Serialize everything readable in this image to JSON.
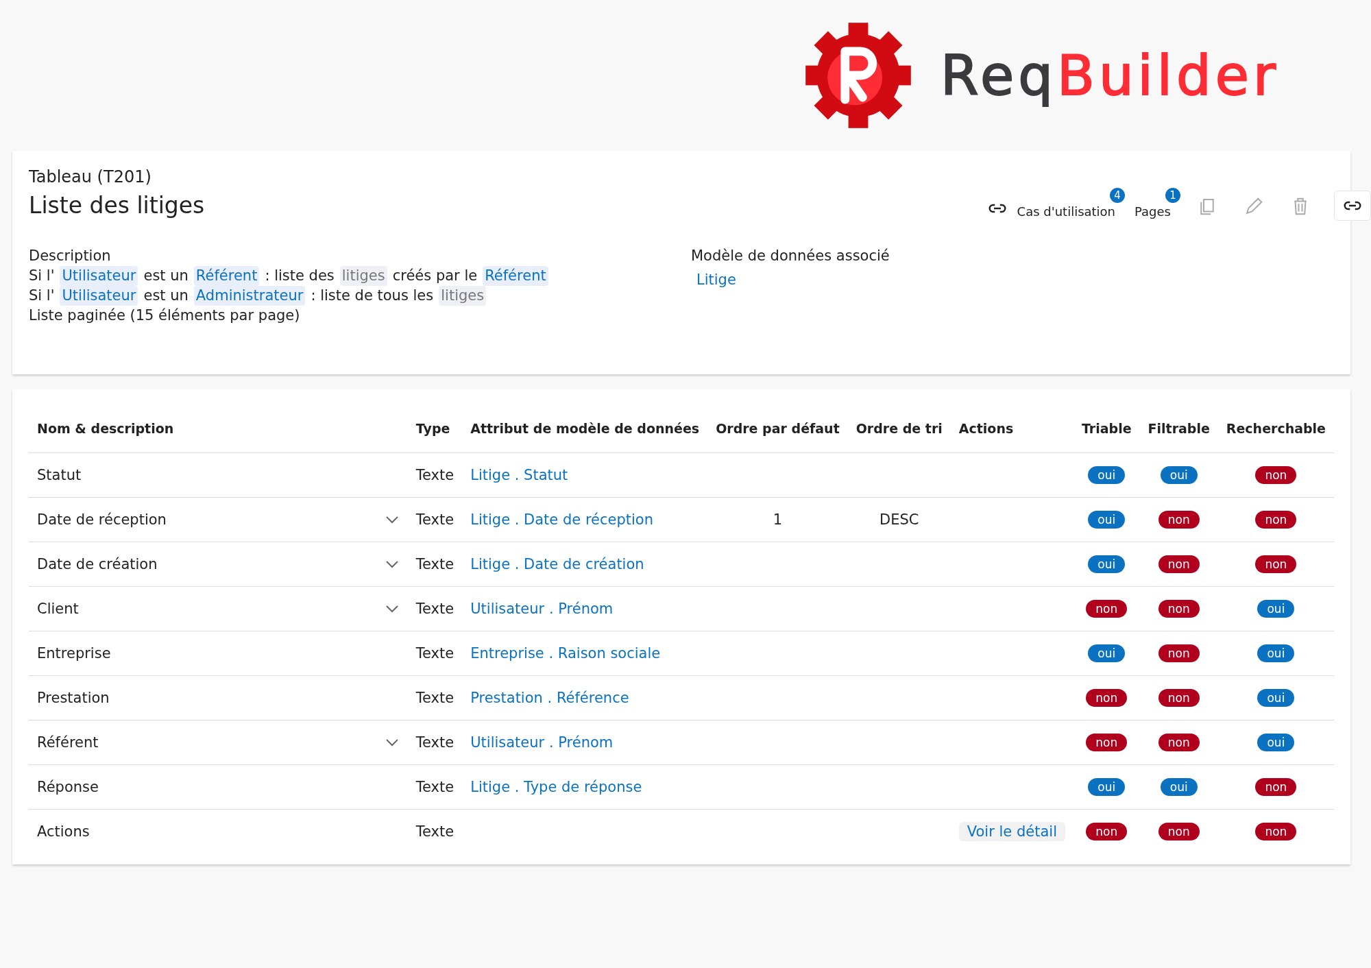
{
  "logo": {
    "part_1": "Req",
    "part_2": "Builder"
  },
  "header": {
    "kind_label": "Tableau (T201)",
    "title": "Liste des litiges",
    "toolbar": {
      "link_label": "Cas d'utilisation",
      "link_count": "4",
      "pages_label": "Pages",
      "pages_count": "1"
    },
    "description": {
      "heading": "Description",
      "lines": [
        [
          {
            "kind": "text",
            "text": "Si l'"
          },
          {
            "kind": "entity",
            "text": "Utilisateur"
          },
          {
            "kind": "text",
            "text": "est un"
          },
          {
            "kind": "entity",
            "text": "Référent"
          },
          {
            "kind": "text",
            "text": ": liste des"
          },
          {
            "kind": "concept",
            "text": "litiges"
          },
          {
            "kind": "text",
            "text": "créés par le"
          },
          {
            "kind": "entity",
            "text": "Référent"
          }
        ],
        [
          {
            "kind": "text",
            "text": "Si l'"
          },
          {
            "kind": "entity",
            "text": "Utilisateur"
          },
          {
            "kind": "text",
            "text": "est un"
          },
          {
            "kind": "entity",
            "text": "Administrateur"
          },
          {
            "kind": "text",
            "text": ": liste de tous les"
          },
          {
            "kind": "concept",
            "text": "litiges"
          }
        ],
        [
          {
            "kind": "text",
            "text": "Liste paginée (15 éléments par page)"
          }
        ]
      ]
    },
    "data_model": {
      "heading": "Modèle de données associé",
      "items": [
        "Litige"
      ]
    }
  },
  "table": {
    "columns": [
      "Nom & description",
      "Type",
      "Attribut de modèle de données",
      "Ordre par défaut",
      "Ordre de tri",
      "Actions",
      "Triable",
      "Filtrable",
      "Recherchable"
    ],
    "rows": [
      {
        "name": "Statut",
        "expandable": false,
        "type": "Texte",
        "attribute": "Litige . Statut",
        "default_order": "",
        "sort_order": "",
        "action": "",
        "triable": {
          "label": "oui",
          "on": true
        },
        "filtrable": {
          "label": "oui",
          "on": true
        },
        "recherchable": {
          "label": "non",
          "on": false
        }
      },
      {
        "name": "Date de réception",
        "expandable": true,
        "type": "Texte",
        "attribute": "Litige . Date de réception",
        "default_order": "1",
        "sort_order": "DESC",
        "action": "",
        "triable": {
          "label": "oui",
          "on": true
        },
        "filtrable": {
          "label": "non",
          "on": false
        },
        "recherchable": {
          "label": "non",
          "on": false
        }
      },
      {
        "name": "Date de création",
        "expandable": true,
        "type": "Texte",
        "attribute": "Litige . Date de création",
        "default_order": "",
        "sort_order": "",
        "action": "",
        "triable": {
          "label": "oui",
          "on": true
        },
        "filtrable": {
          "label": "non",
          "on": false
        },
        "recherchable": {
          "label": "non",
          "on": false
        }
      },
      {
        "name": "Client",
        "expandable": true,
        "type": "Texte",
        "attribute": "Utilisateur . Prénom",
        "default_order": "",
        "sort_order": "",
        "action": "",
        "triable": {
          "label": "non",
          "on": false
        },
        "filtrable": {
          "label": "non",
          "on": false
        },
        "recherchable": {
          "label": "oui",
          "on": true
        }
      },
      {
        "name": "Entreprise",
        "expandable": false,
        "type": "Texte",
        "attribute": "Entreprise . Raison sociale",
        "default_order": "",
        "sort_order": "",
        "action": "",
        "triable": {
          "label": "oui",
          "on": true
        },
        "filtrable": {
          "label": "non",
          "on": false
        },
        "recherchable": {
          "label": "oui",
          "on": true
        }
      },
      {
        "name": "Prestation",
        "expandable": false,
        "type": "Texte",
        "attribute": "Prestation . Référence",
        "default_order": "",
        "sort_order": "",
        "action": "",
        "triable": {
          "label": "non",
          "on": false
        },
        "filtrable": {
          "label": "non",
          "on": false
        },
        "recherchable": {
          "label": "oui",
          "on": true
        }
      },
      {
        "name": "Référent",
        "expandable": true,
        "type": "Texte",
        "attribute": "Utilisateur . Prénom",
        "default_order": "",
        "sort_order": "",
        "action": "",
        "triable": {
          "label": "non",
          "on": false
        },
        "filtrable": {
          "label": "non",
          "on": false
        },
        "recherchable": {
          "label": "oui",
          "on": true
        }
      },
      {
        "name": "Réponse",
        "expandable": false,
        "type": "Texte",
        "attribute": "Litige . Type de réponse",
        "default_order": "",
        "sort_order": "",
        "action": "",
        "triable": {
          "label": "oui",
          "on": true
        },
        "filtrable": {
          "label": "oui",
          "on": true
        },
        "recherchable": {
          "label": "non",
          "on": false
        }
      },
      {
        "name": "Actions",
        "expandable": false,
        "type": "Texte",
        "attribute": "",
        "default_order": "",
        "sort_order": "",
        "action": "Voir le détail",
        "triable": {
          "label": "non",
          "on": false
        },
        "filtrable": {
          "label": "non",
          "on": false
        },
        "recherchable": {
          "label": "non",
          "on": false
        }
      }
    ]
  }
}
